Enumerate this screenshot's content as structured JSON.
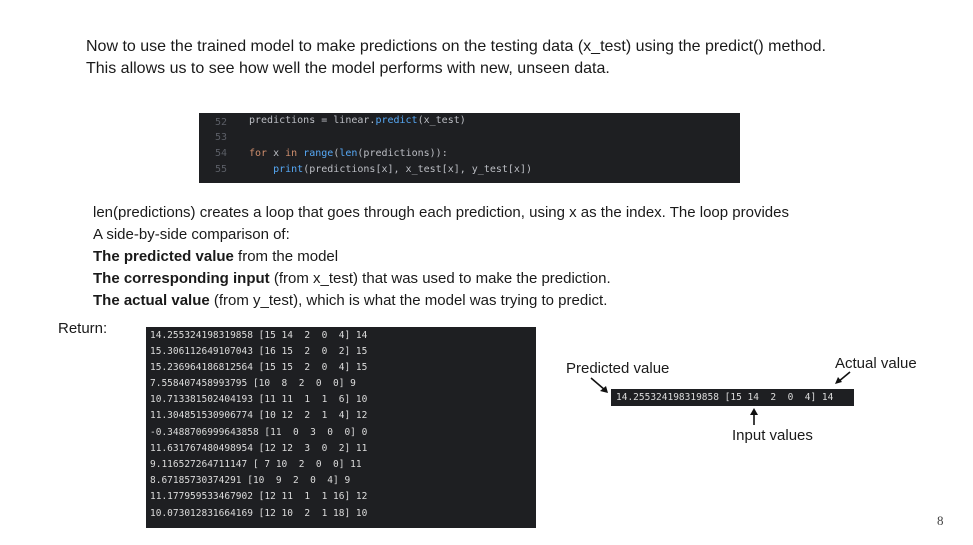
{
  "intro": {
    "line1": "Now to use the trained model to make predictions on the testing data (x_test) using the predict() method.",
    "line2": "This allows us to see how well the model performs with new, unseen data."
  },
  "code": {
    "line_numbers": [
      "52",
      "53",
      "54",
      "55"
    ],
    "line52_var": "predictions = linear.",
    "line52_fn": "predict",
    "line52_rest": "(x_test)",
    "line54_kw1": "for",
    "line54_mid": " x ",
    "line54_kw2": "in",
    "line54_sp": " ",
    "line54_fn": "range",
    "line54_paren": "(",
    "line54_fn2": "len",
    "line54_rest": "(predictions)):",
    "line55_indent": "    ",
    "line55_fn": "print",
    "line55_rest": "(predictions[x], x_test[x], y_test[x])"
  },
  "explain": {
    "line1": "len(predictions) creates a loop that goes through each prediction, using x as the index. The loop provides",
    "line2": "A side-by-side comparison of:",
    "item1_bold": "The predicted value",
    "item1_rest": " from the model",
    "item2_bold": "The corresponding input",
    "item2_rest": " (from x_test) that was used to make the prediction.",
    "item3_bold": "The actual value",
    "item3_rest": " (from y_test), which is what the model was trying to predict."
  },
  "return_label": "Return:",
  "output_rows": [
    "14.255324198319858 [15 14  2  0  4] 14",
    "15.306112649107043 [16 15  2  0  2] 15",
    "15.236964186812564 [15 15  2  0  4] 15",
    "7.558407458993795 [10  8  2  0  0] 9",
    "10.713381502404193 [11 11  1  1  6] 10",
    "11.304851530906774 [10 12  2  1  4] 12",
    "-0.3488706999643858 [11  0  3  0  0] 0",
    "11.631767480498954 [12 12  3  0  2] 11",
    "9.116527264711147 [ 7 10  2  0  0] 11",
    "8.67185730374291 [10  9  2  0  4] 9",
    "11.177959533467902 [12 11  1  1 16] 12",
    "10.073012831664169 [12 10  2  1 18] 10"
  ],
  "callout": {
    "sample": "14.255324198319858 [15 14  2  0  4] 14",
    "predicted_label": "Predicted value",
    "actual_label": "Actual value",
    "input_label": "Input values"
  },
  "page_number": "8"
}
